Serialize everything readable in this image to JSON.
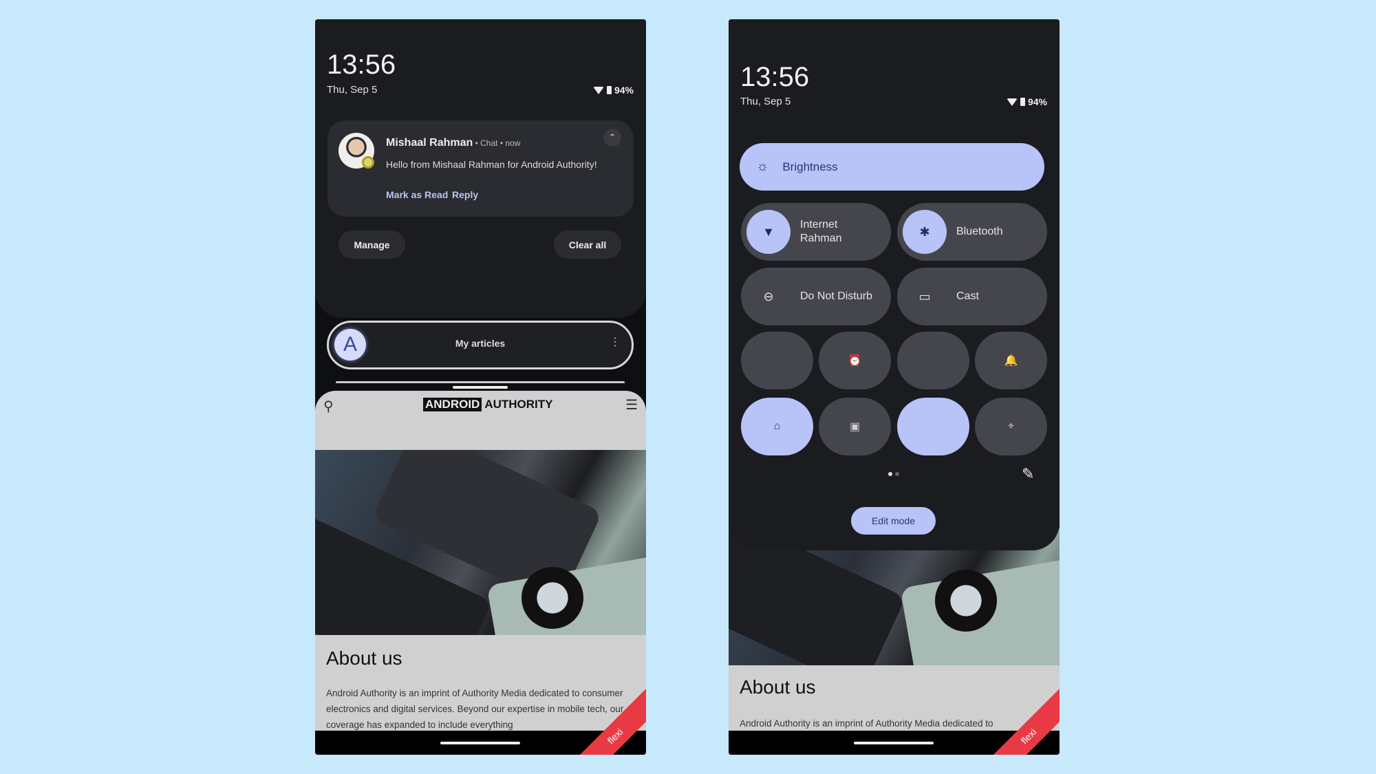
{
  "status": {
    "time": "13:56",
    "date": "Thu, Sep 5",
    "battery": "94%"
  },
  "notification": {
    "sender": "Mishaal Rahman",
    "meta": " • Chat • now",
    "message": "Hello from Mishaal Rahman for Android Authority!",
    "actions": [
      "Mark as Read",
      "Reply"
    ]
  },
  "shade": {
    "manage": "Manage",
    "clear_all": "Clear all"
  },
  "bubble": {
    "title": "My articles",
    "logo_letter": "A"
  },
  "website": {
    "logo_left": "ANDROID",
    "logo_right": "AUTHORITY",
    "heading": "About us",
    "paragraph": "Android Authority is an imprint of Authority Media dedicated to consumer electronics and digital services. Beyond our expertise in mobile tech, our coverage has expanded to include everything",
    "paragraph_short": "Android Authority is an imprint of Authority Media dedicated to"
  },
  "quick_settings": {
    "brightness": "Brightness",
    "internet": {
      "label": "Internet",
      "sub": "Rahman"
    },
    "bluetooth": "Bluetooth",
    "dnd": "Do Not Disturb",
    "cast": "Cast",
    "edit_mode": "Edit mode",
    "page": 1,
    "pages": 2
  },
  "watermark": "flexi",
  "colors": {
    "accent": "#b8c3f8",
    "background": "#c8e9fb",
    "tile": "#45464d"
  }
}
